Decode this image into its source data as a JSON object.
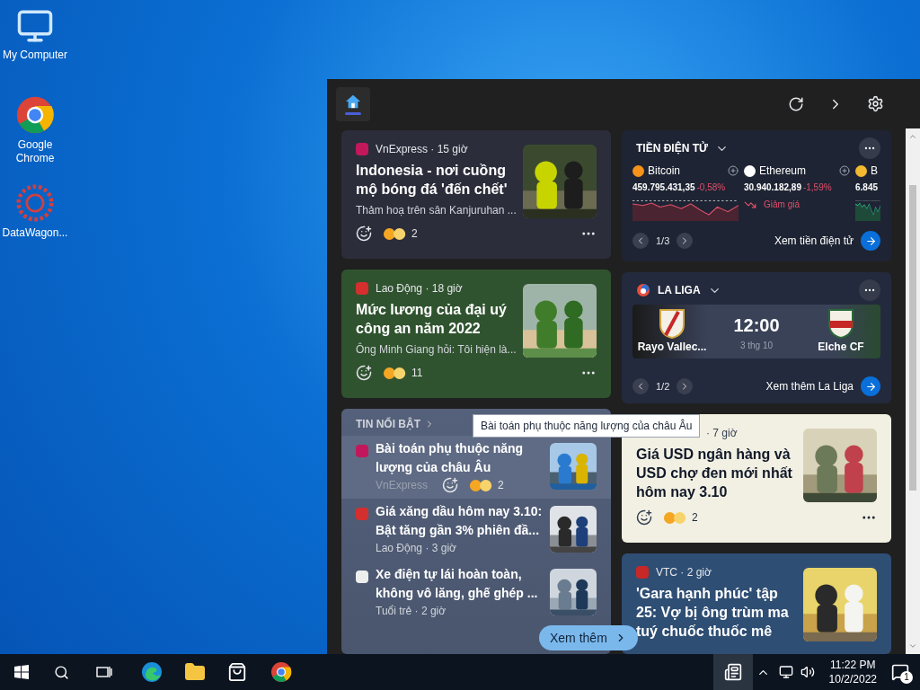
{
  "desktop_icons": [
    {
      "label": "My Computer",
      "kind": "computer"
    },
    {
      "label": "Google Chrome",
      "kind": "chrome"
    },
    {
      "label": "DataWagon...",
      "kind": "app"
    }
  ],
  "widgets": {
    "header": {
      "home_selected": true
    },
    "left": [
      {
        "kind": "article",
        "logo": {
          "color": "#c2185b"
        },
        "meta": "VnExpress · 15 giờ",
        "title": "Indonesia - nơi cuồng mộ bóng đá 'đến chết'",
        "summary": "Thảm hoạ trên sân Kanjuruhan ...",
        "count": "2",
        "color": "#2b2d3a",
        "light": false
      },
      {
        "kind": "article",
        "logo": {
          "color": "#d32f2f"
        },
        "meta": "Lao Động · 18 giờ",
        "title": "Mức lương của đại uý công an năm 2022",
        "summary": "Ông Minh Giang hỏi: Tôi hiện là...",
        "count": "11",
        "color": "#30532f",
        "light": false
      },
      {
        "kind": "top_stories",
        "heading": "TIN NỔI BẬT",
        "more": "Xem thêm",
        "items": [
          {
            "logo": {
              "color": "#c2185b"
            },
            "title": "Bài toán phụ thuộc năng lượng của châu Âu",
            "meta": "VnExpress",
            "count": "2",
            "hovered": true
          },
          {
            "logo": {
              "color": "#d32f2f"
            },
            "title": "Giá xăng dầu hôm nay 3.10: Bật tăng gần 3% phiên đầ...",
            "meta": "Lao Động · 3 giờ",
            "hovered": false
          },
          {
            "logo": {
              "color": "#eeeeee"
            },
            "title": "Xe điện tự lái hoàn toàn, không vô lăng, ghế ghép ...",
            "meta": "Tuổi trẻ · 2 giờ",
            "hovered": false
          }
        ]
      }
    ],
    "right": [
      {
        "kind": "crypto",
        "title": "TIỀN ĐIỆN TỬ",
        "page": "1/3",
        "link": "Xem tiền điện tử",
        "coins": [
          {
            "name": "Bitcoin",
            "price": "459.795.431,35",
            "change": "-0,58%",
            "falling": true,
            "color": "#f7931a"
          },
          {
            "name": "Ethereum",
            "price": "30.940.182,89",
            "change": "-1,59%",
            "falling": true,
            "note": "Giảm giá",
            "color": "#ffffff"
          },
          {
            "name": "B",
            "price": "6.845",
            "falling": false,
            "color": "#f3ba2f"
          }
        ]
      },
      {
        "kind": "sports",
        "title": "LA LIGA",
        "home": "Rayo Vallec...",
        "away": "Elche CF",
        "time": "12:00",
        "date": "3 thg 10",
        "page": "1/2",
        "link": "Xem thêm La Liga"
      },
      {
        "kind": "article",
        "meta": "· 7 giờ",
        "title": "Giá USD ngân hàng và USD chợ đen mới nhất hôm nay 3.10",
        "count": "2",
        "color": "#f2f0e3",
        "light": true,
        "covered": true
      },
      {
        "kind": "article",
        "logo": {
          "color": "#c62828"
        },
        "meta": "VTC · 2 giờ",
        "title": "'Gara hạnh phúc' tập 25: Vợ bị ông trùm ma tuý chuốc thuốc mê",
        "color": "#2f4e74",
        "light": false
      }
    ],
    "tooltip": "Bài toán phụ thuộc năng lượng của châu Âu"
  },
  "taskbar": {
    "time": "11:22 PM",
    "date": "10/2/2022",
    "notifications": "1"
  }
}
